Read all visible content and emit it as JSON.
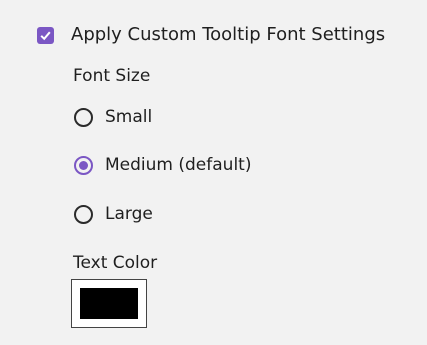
{
  "tooltip_settings": {
    "apply_custom": {
      "label": "Apply Custom Tooltip Font Settings",
      "checked": true
    },
    "font_size": {
      "label": "Font Size",
      "options": [
        {
          "label": "Small",
          "selected": false
        },
        {
          "label": "Medium (default)",
          "selected": true
        },
        {
          "label": "Large",
          "selected": false
        }
      ]
    },
    "text_color": {
      "label": "Text Color",
      "value": "#000000"
    }
  },
  "colors": {
    "accent": "#7b57c4",
    "panel_background": "#f2f2f2",
    "text": "#1f1f1f"
  }
}
